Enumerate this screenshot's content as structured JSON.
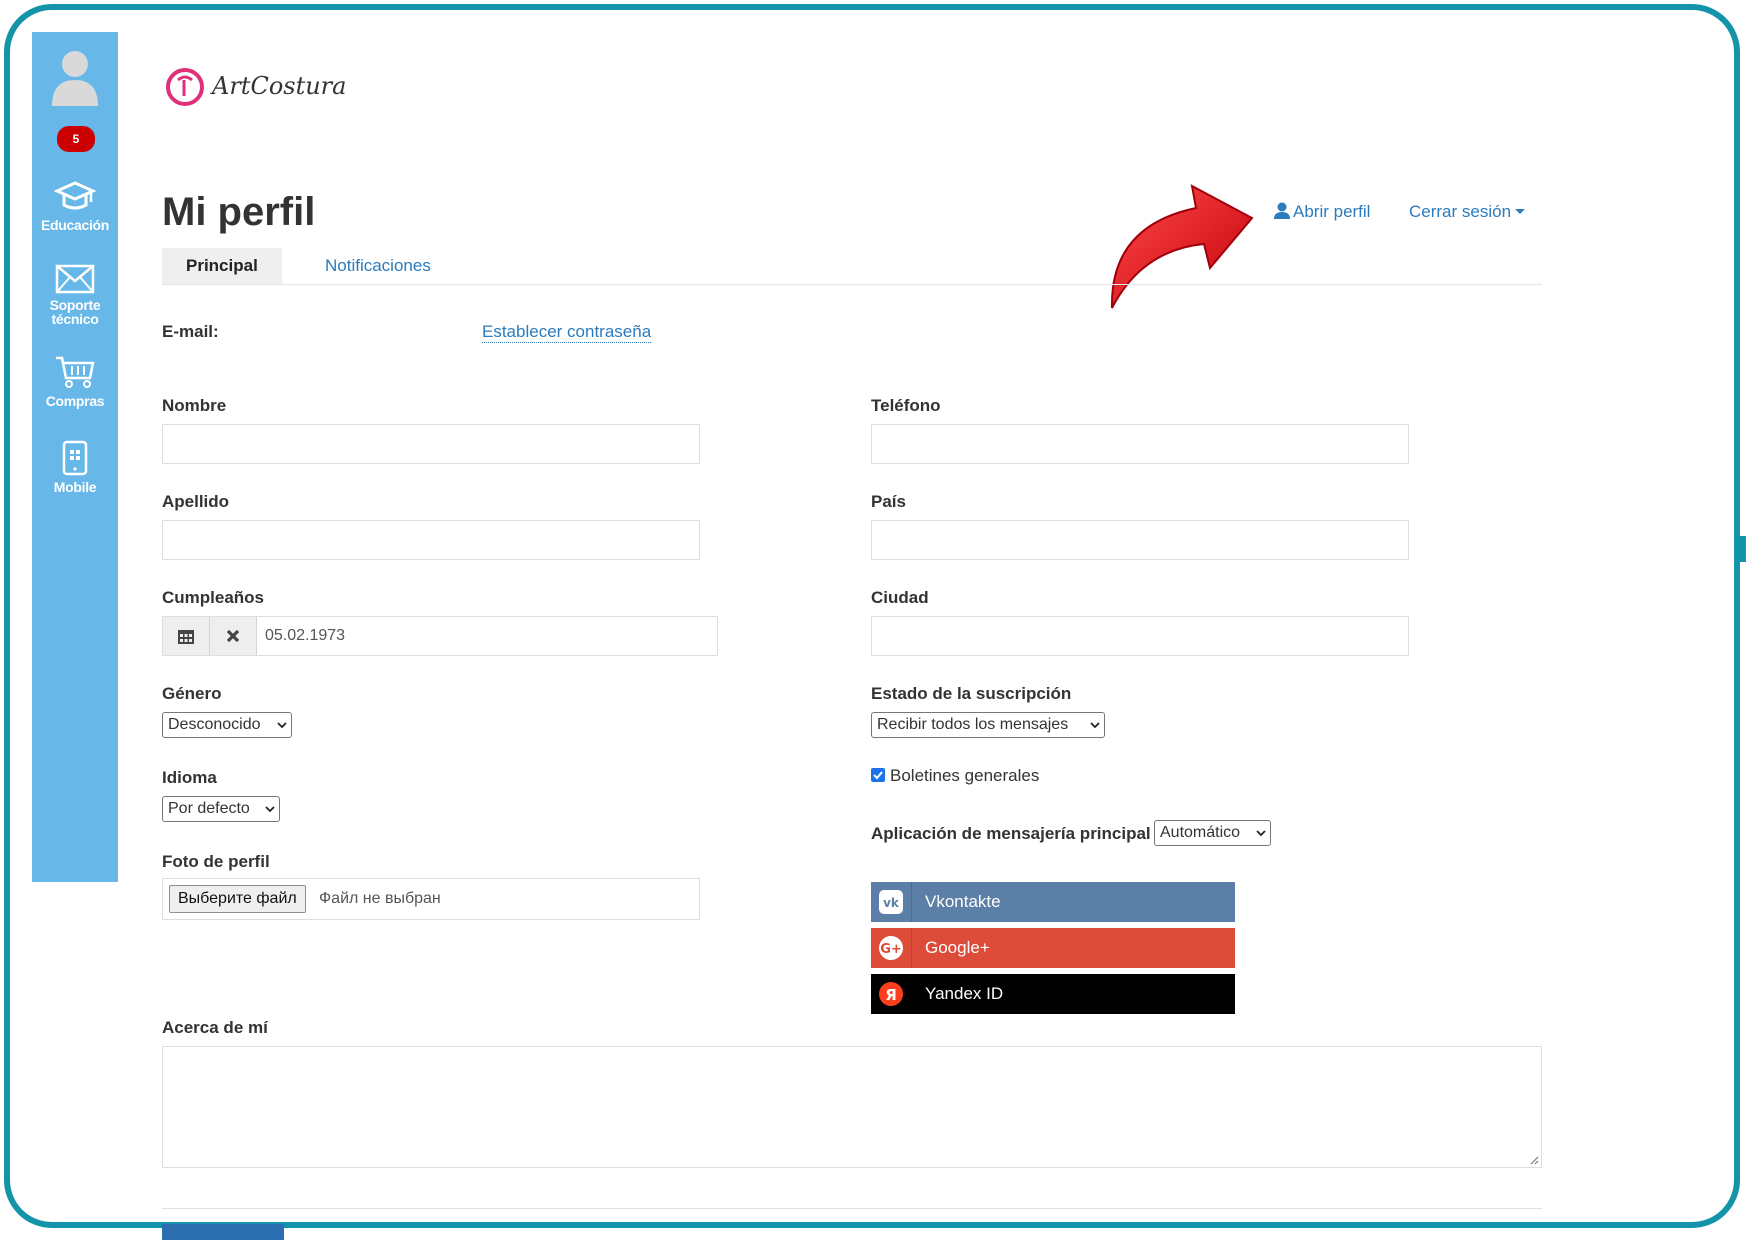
{
  "sidebar": {
    "badge_count": "5",
    "items": [
      {
        "label": "Educación",
        "icon": "graduation-cap-icon"
      },
      {
        "label": "Soporte técnico",
        "icon": "envelope-icon"
      },
      {
        "label": "Compras",
        "icon": "cart-icon"
      },
      {
        "label": "Mobile",
        "icon": "mobile-icon"
      }
    ]
  },
  "logo": {
    "text": "ArtCostura",
    "icon": "logo-emblem-icon"
  },
  "header": {
    "title": "Mi perfil",
    "open_profile": "Abrir perfil",
    "logout": "Cerrar sesión"
  },
  "tabs": [
    {
      "label": "Principal",
      "active": true
    },
    {
      "label": "Notificaciones",
      "active": false
    }
  ],
  "form": {
    "email_label": "E-mail:",
    "set_password": "Establecer contraseña",
    "nombre_label": "Nombre",
    "nombre_value": "",
    "apellido_label": "Apellido",
    "apellido_value": "",
    "cumpleanos_label": "Cumpleaños",
    "cumpleanos_value": "05.02.1973",
    "genero_label": "Género",
    "genero_value": "Desconocido",
    "idioma_label": "Idioma",
    "idioma_value": "Por defecto",
    "foto_label": "Foto de perfil",
    "file_button": "Выберите файл",
    "file_status": "Файл не выбран",
    "telefono_label": "Teléfono",
    "telefono_value": "",
    "pais_label": "País",
    "pais_value": "",
    "ciudad_label": "Ciudad",
    "ciudad_value": "",
    "suscripcion_label": "Estado de la suscripción",
    "suscripcion_value": "Recibir todos los mensajes",
    "boletines_label": "Boletines generales",
    "boletines_checked": true,
    "mensajeria_label": "Aplicación de mensajería principal",
    "mensajeria_value": "Automático",
    "acerca_label": "Acerca de mí",
    "acerca_value": ""
  },
  "social": [
    {
      "label": "Vkontakte",
      "color": "#5b7fa6",
      "icon": "vk-icon"
    },
    {
      "label": "Google+",
      "color": "#dd4b39",
      "icon": "google-plus-icon"
    },
    {
      "label": "Yandex ID",
      "color": "#000000",
      "icon": "yandex-icon"
    }
  ],
  "colors": {
    "frame": "#1394a8",
    "sidebar": "#67b8e8",
    "link": "#2b7bbd",
    "arrow": "#ee1c24"
  }
}
